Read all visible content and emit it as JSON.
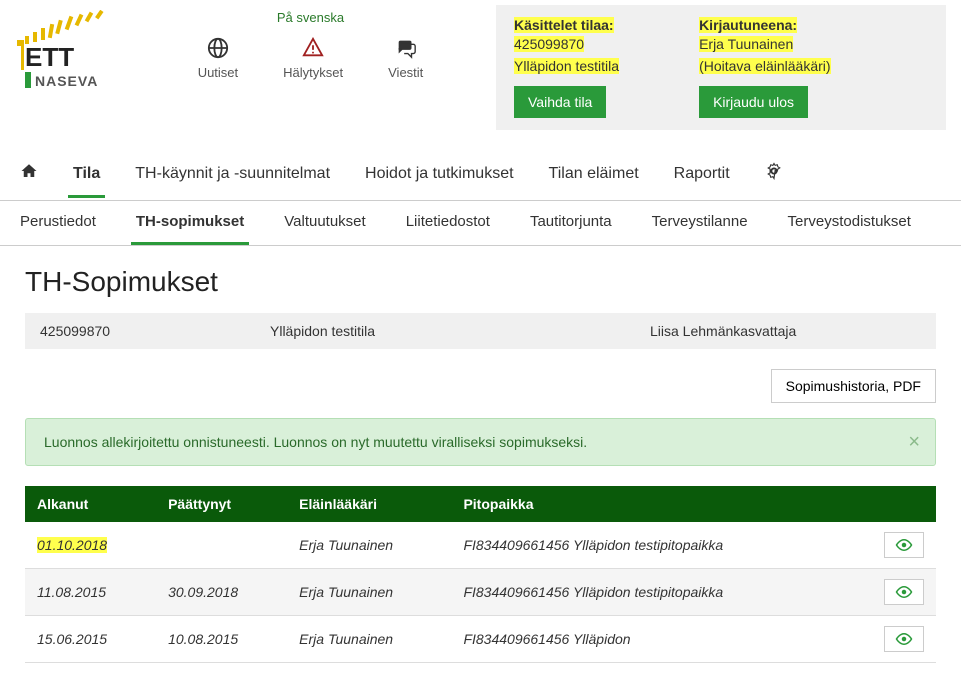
{
  "header": {
    "lang_link": "På svenska",
    "icon_nav": {
      "news": "Uutiset",
      "alerts": "Hälytykset",
      "messages": "Viestit"
    },
    "handling": {
      "label": "Käsittelet tilaa:",
      "id": "425099870",
      "name": "Ylläpidon testitila",
      "button": "Vaihda tila"
    },
    "logged_in": {
      "label": "Kirjautuneena:",
      "name": "Erja Tuunainen",
      "role": "(Hoitava eläinlääkäri)",
      "button": "Kirjaudu ulos"
    }
  },
  "main_tabs": {
    "tila": "Tila",
    "th_kaynnit": "TH-käynnit ja -suunnitelmat",
    "hoidot": "Hoidot ja tutkimukset",
    "elaimet": "Tilan eläimet",
    "raportit": "Raportit"
  },
  "sub_tabs": {
    "perustiedot": "Perustiedot",
    "th_sopimukset": "TH-sopimukset",
    "valtuutukset": "Valtuutukset",
    "liitetiedostot": "Liitetiedostot",
    "tautitorjunta": "Tautitorjunta",
    "terveystilanne": "Terveystilanne",
    "terveystodistukset": "Terveystodistukset"
  },
  "page_title": "TH-Sopimukset",
  "farm_row": {
    "id": "425099870",
    "name": "Ylläpidon testitila",
    "owner": "Liisa Lehmänkasvattaja"
  },
  "pdf_button": "Sopimushistoria, PDF",
  "alert_text": "Luonnos allekirjoitettu onnistuneesti. Luonnos on nyt muutettu viralliseksi sopimukseksi.",
  "table": {
    "headers": {
      "started": "Alkanut",
      "ended": "Päättynyt",
      "vet": "Eläinlääkäri",
      "place": "Pitopaikka"
    },
    "rows": [
      {
        "started": "01.10.2018",
        "ended": "",
        "vet": "Erja Tuunainen",
        "place": "FI834409661456 Ylläpidon testipitopaikka",
        "highlight": true
      },
      {
        "started": "11.08.2015",
        "ended": "30.09.2018",
        "vet": "Erja Tuunainen",
        "place": "FI834409661456 Ylläpidon testipitopaikka"
      },
      {
        "started": "15.06.2015",
        "ended": "10.08.2015",
        "vet": "Erja Tuunainen",
        "place": "FI834409661456 Ylläpidon"
      }
    ]
  }
}
